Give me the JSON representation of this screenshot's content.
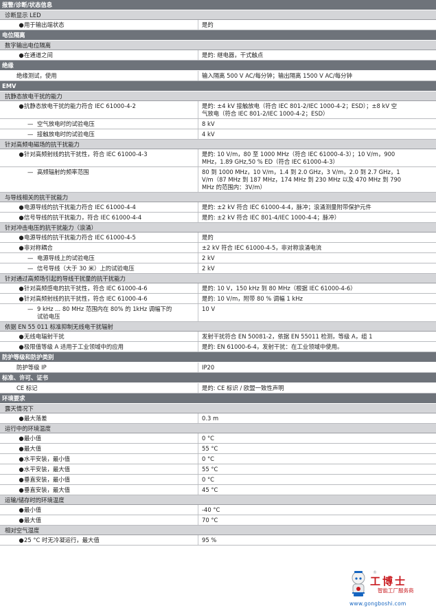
{
  "colors": {
    "category_bg": "#6e737a",
    "sub_bg": "#d4d5d8",
    "row_border": "#b9bbbf",
    "logo_red": "#c8191e",
    "logo_blue": "#1565c0"
  },
  "rows": [
    {
      "t": "cat",
      "label": "报警/诊断/状态信息"
    },
    {
      "t": "sub",
      "label": "诊断显示 LED"
    },
    {
      "t": "data",
      "m": "b",
      "label": "用于输出端状态",
      "value": [
        "是的"
      ]
    },
    {
      "t": "cat",
      "label": "电位隔离"
    },
    {
      "t": "sub",
      "label": "数字输出电位隔离"
    },
    {
      "t": "data",
      "m": "b",
      "label": "在通道之间",
      "value": [
        "是的: 继电器，干式触点"
      ]
    },
    {
      "t": "cat",
      "label": "绝缘"
    },
    {
      "t": "data",
      "m": "p",
      "label": "绝缘测试，使用",
      "value": [
        "输入隔离 500 V AC/每分钟；输出隔离 1500 V AC/每分钟"
      ]
    },
    {
      "t": "cat",
      "label": "EMV"
    },
    {
      "t": "sub",
      "label": "抗静态放电干扰的能力"
    },
    {
      "t": "data",
      "m": "b",
      "label": "抗静态放电干扰的能力符合 IEC 61000-4-2",
      "value": [
        "是的: ±4 kV 接触放电（符合 IEC 801-2/IEC 1000-4-2；ESD）；±8 kV 空",
        "气放电（符合 IEC 801-2/IEC 1000-4-2；ESD）"
      ]
    },
    {
      "t": "data",
      "m": "d",
      "label": "空气放电时的试验电压",
      "value": [
        "8 kV"
      ]
    },
    {
      "t": "data",
      "m": "d",
      "label": "接触放电时的试验电压",
      "value": [
        "4 kV"
      ]
    },
    {
      "t": "sub",
      "label": "针对高频电磁场的抗干扰能力"
    },
    {
      "t": "data",
      "m": "b",
      "label": "针对高频射线的抗干扰性，符合 IEC 61000-4-3",
      "value": [
        "是的: 10 V/m，80 至 1000 MHz（符合 IEC 61000-4-3）；10 V/m，900",
        "MHz，1.89 GHz,50 % ED（符合 IEC 61000-4-3）"
      ]
    },
    {
      "t": "data",
      "m": "d",
      "label": "高频辐射的频率范围",
      "value": [
        "80 到 1000 MHz，10 V/m，1.4 到 2.0 GHz，3 V/m，2.0 到 2.7 GHz，1",
        "V/m（87 MHz 到 187 MHz，174 MHz 到 230 MHz 以及 470 MHz 到 790",
        "MHz 的范围内：3V/m）"
      ]
    },
    {
      "t": "sub",
      "label": "与导线相关的抗干扰能力"
    },
    {
      "t": "data",
      "m": "b",
      "label": "电源导线的抗干扰能力符合 IEC 61000-4-4",
      "value": [
        "是的: ±2 kV 符合 IEC 61000-4-4，脉冲；浪涌测量附带保护元件"
      ]
    },
    {
      "t": "data",
      "m": "b",
      "label": "信号导线的抗干扰能力，符合 IEC 61000-4-4",
      "value": [
        "是的: ±2 kV 符合 IEC 801-4/IEC 1000-4-4；脉冲）"
      ]
    },
    {
      "t": "sub",
      "label": "针对冲击电压的抗干扰能力（浪涌）"
    },
    {
      "t": "data",
      "m": "b",
      "label": "电源导线的抗干扰能力符合 IEC 61000-4-5",
      "value": [
        "是的"
      ]
    },
    {
      "t": "data",
      "m": "b",
      "label": "非对称耦合",
      "value": [
        "±2 kV 符合 IEC 61000-4-5，非对称浪涌电流"
      ]
    },
    {
      "t": "data",
      "m": "d",
      "label": "电源导线上的试验电压",
      "value": [
        "2 kV"
      ]
    },
    {
      "t": "data",
      "m": "d",
      "label": "信号导线（大于 30 米）上的试验电压",
      "value": [
        "2 kV"
      ]
    },
    {
      "t": "sub",
      "label": "针对通过高频场引起的导线干扰量的抗干扰能力"
    },
    {
      "t": "data",
      "m": "b",
      "label": "针对高频感电的抗干扰性，符合 IEC 61000-4-6",
      "value": [
        "是的: 10 V，150 kHz 到 80 MHz（根据 IEC 61000-4-6）"
      ]
    },
    {
      "t": "data",
      "m": "b",
      "label": "针对高频射线的抗干扰性，符合 IEC 61000-4-6",
      "value": [
        "是的: 10 V/m，附带 80 % 调幅 1 kHz"
      ]
    },
    {
      "t": "data",
      "m": "d",
      "label": "9 kHz ... 80 MHz 范围内在 80% 的 1kHz 调幅下的",
      "label2": "试验电压",
      "value": [
        "10 V"
      ]
    },
    {
      "t": "sub",
      "label": "依据 EN 55 011 标准抑制无线电干扰辐射"
    },
    {
      "t": "data",
      "m": "b",
      "label": "无线电辐射干扰",
      "value": [
        "发射干扰符合 EN 50081-2，依据 EN 55011 检测，等级 A，组 1"
      ]
    },
    {
      "t": "data",
      "m": "b",
      "label": "极限值等级 A 适用于工业领域中的应用",
      "value": [
        "是的: EN 61000-6-4，发射干扰：在工业领域中使用。"
      ]
    },
    {
      "t": "cat",
      "label": "防护等级和防护类别"
    },
    {
      "t": "data",
      "m": "p",
      "label": "防护等级 IP",
      "value": [
        "IP20"
      ]
    },
    {
      "t": "cat",
      "label": "标准、许可、证书"
    },
    {
      "t": "data",
      "m": "p",
      "label": "CE 标记",
      "value": [
        "是的: CE 标识 / 欧盟一致性声明"
      ]
    },
    {
      "t": "cat",
      "label": "环境要求"
    },
    {
      "t": "sub",
      "label": "露天情况下"
    },
    {
      "t": "data",
      "m": "b",
      "label": "最大落差",
      "value": [
        "0.3 m"
      ]
    },
    {
      "t": "sub",
      "label": "运行中的环境温度"
    },
    {
      "t": "data",
      "m": "b",
      "label": "最小值",
      "value": [
        "0 °C"
      ]
    },
    {
      "t": "data",
      "m": "b",
      "label": "最大值",
      "value": [
        "55 °C"
      ]
    },
    {
      "t": "data",
      "m": "b",
      "label": "水平安装，最小值",
      "value": [
        "0 °C"
      ]
    },
    {
      "t": "data",
      "m": "b",
      "label": "水平安装，最大值",
      "value": [
        "55 °C"
      ]
    },
    {
      "t": "data",
      "m": "b",
      "label": "垂直安装，最小值",
      "value": [
        "0 °C"
      ]
    },
    {
      "t": "data",
      "m": "b",
      "label": "垂直安装，最大值",
      "value": [
        "45 °C"
      ]
    },
    {
      "t": "sub",
      "label": "运输/储存时的环境温度"
    },
    {
      "t": "data",
      "m": "b",
      "label": "最小值",
      "value": [
        "-40 °C"
      ]
    },
    {
      "t": "data",
      "m": "b",
      "label": "最大值",
      "value": [
        "70 °C"
      ]
    },
    {
      "t": "sub",
      "label": "相对空气湿度"
    },
    {
      "t": "data",
      "m": "b",
      "label": "25 °C 时无冷凝运行，最大值",
      "value": [
        "95 %"
      ]
    }
  ],
  "glyphs": {
    "bullet": "●",
    "dash": "—"
  },
  "logo": {
    "brand": "工博士",
    "slogan": "智能工厂服务商",
    "url": "www.gongboshi.com",
    "mark": "®"
  }
}
